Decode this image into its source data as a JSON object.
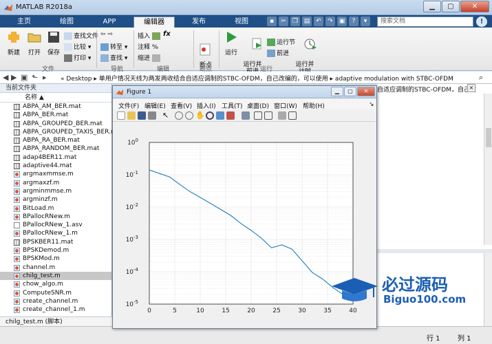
{
  "window": {
    "title": "MATLAB R2018a"
  },
  "tabs": [
    {
      "label": "主页"
    },
    {
      "label": "绘图"
    },
    {
      "label": "APP"
    },
    {
      "label": "编辑器"
    },
    {
      "label": "发布"
    },
    {
      "label": "视图"
    }
  ],
  "search": {
    "placeholder": "搜索文档"
  },
  "ribbon": {
    "new_label": "新建",
    "open_label": "打开",
    "save_label": "保存",
    "find_files": "查找文件",
    "compare": "比较",
    "print": "打印",
    "back_label": "",
    "goto": "转至",
    "find": "查找",
    "insert": "插入",
    "fx": "fx",
    "comment": "注释",
    "pct": "%",
    "indent": "缩进",
    "breakpoints": "断点",
    "run": "运行",
    "run_advance": "运行并\n前进",
    "run_section": "运行节",
    "advance": "前进",
    "run_time": "运行并\n计时",
    "groups": {
      "file": "文件",
      "nav": "导航",
      "edit": "编辑",
      "breakpoints": "断点",
      "run": "运行"
    }
  },
  "address": {
    "path": "« Desktop ▸ 单用户情况天线为两发两收结合自适应调制的STBC-OFDM，自己改编的，可以使用 ▸ adaptive modulation with STBC-OFDM"
  },
  "left_panel": {
    "title": "当前文件夹",
    "column_header": "名称 ▲",
    "files": [
      {
        "name": "ABPA_AM_BER.mat",
        "type": "mat"
      },
      {
        "name": "ABPA_BER.mat",
        "type": "mat"
      },
      {
        "name": "ABPA_GROUPED_BER.mat",
        "type": "mat"
      },
      {
        "name": "ABPA_GROUPED_TAXIS_BER.mat",
        "type": "mat"
      },
      {
        "name": "ABPA_RA_BER.mat",
        "type": "mat"
      },
      {
        "name": "ABPA_RANDOM_BER.mat",
        "type": "mat"
      },
      {
        "name": "adap4BER11.mat",
        "type": "mat"
      },
      {
        "name": "adaptive44.mat",
        "type": "mat"
      },
      {
        "name": "argmaxmmse.m",
        "type": "m"
      },
      {
        "name": "argmaxzf.m",
        "type": "m"
      },
      {
        "name": "argminmmse.m",
        "type": "m"
      },
      {
        "name": "argminzf.m",
        "type": "m"
      },
      {
        "name": "BitLoad.m",
        "type": "m"
      },
      {
        "name": "BPallocRNew.m",
        "type": "m"
      },
      {
        "name": "BPallocRNew_1.asv",
        "type": "asv"
      },
      {
        "name": "BPallocRNew_1.m",
        "type": "m"
      },
      {
        "name": "BPSKBER11.mat",
        "type": "mat"
      },
      {
        "name": "BPSKDemod.m",
        "type": "m"
      },
      {
        "name": "BPSKMod.m",
        "type": "m"
      },
      {
        "name": "channel.m",
        "type": "m"
      },
      {
        "name": "chilg_test.m",
        "type": "m",
        "selected": true
      },
      {
        "name": "chow_algo.m",
        "type": "m"
      },
      {
        "name": "ComputeSNR.m",
        "type": "m"
      },
      {
        "name": "create_channel.m",
        "type": "m"
      },
      {
        "name": "create_channel_1.m",
        "type": "m"
      }
    ],
    "status": "chilg_test.m  (脚本)"
  },
  "right_panel": {
    "path": "自适应调制的STBC-OFDM，自己改",
    "close_label": "×"
  },
  "status": {
    "row": "行 1",
    "col": "列 1"
  },
  "figure": {
    "title": "Figure 1",
    "menu": [
      "文件(F)",
      "编辑(E)",
      "查看(V)",
      "插入(I)",
      "工具(T)",
      "桌面(D)",
      "窗口(W)",
      "帮助(H)"
    ]
  },
  "chart_data": {
    "type": "line",
    "title": "",
    "xlabel": "",
    "ylabel": "",
    "yscale": "log",
    "xlim": [
      0,
      40
    ],
    "ylim": [
      1e-05,
      1
    ],
    "xticks": [
      "0",
      "5",
      "10",
      "15",
      "20",
      "25",
      "30",
      "35",
      "40"
    ],
    "yticks": [
      "10^-5",
      "10^-4",
      "10^-3",
      "10^-2",
      "10^-1",
      "10^0"
    ],
    "grid": true,
    "series": [
      {
        "color": "#0072bd",
        "x": [
          0,
          2,
          4,
          6,
          8,
          10,
          12,
          14,
          16,
          18,
          20,
          22,
          24,
          26,
          28,
          30,
          32,
          34,
          36,
          38
        ],
        "y": [
          0.14,
          0.11,
          0.085,
          0.05,
          0.03,
          0.02,
          0.013,
          0.0085,
          0.0055,
          0.0031,
          0.0019,
          0.0011,
          0.00055,
          0.00068,
          0.0005,
          0.00022,
          9.5e-05,
          6e-05,
          3.3e-05,
          2e-05
        ]
      }
    ]
  },
  "watermark": {
    "text_cn": "必过源码",
    "text_en": "Biguo100.com"
  }
}
